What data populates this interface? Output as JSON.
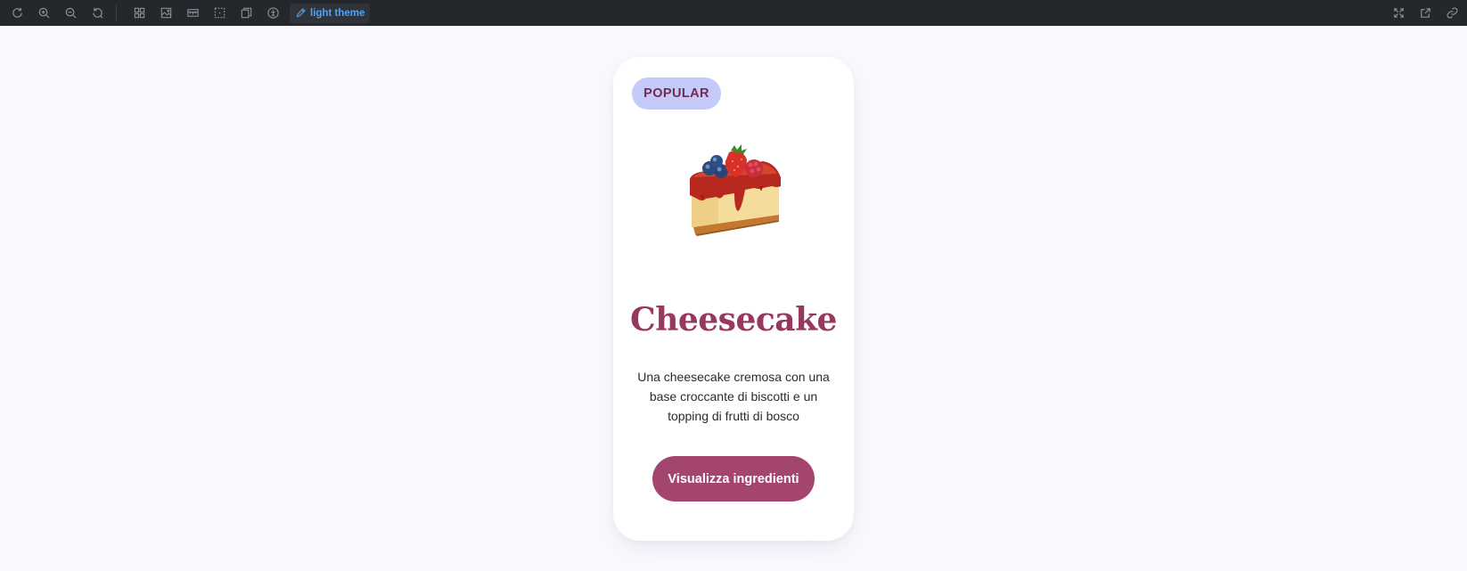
{
  "toolbar": {
    "left_icons": [
      "refresh-icon",
      "zoom-in-icon",
      "zoom-out-icon",
      "reset-zoom-icon"
    ],
    "view_icons": [
      "grid-icon",
      "image-icon",
      "ruler-icon",
      "selection-icon",
      "layers-icon",
      "accessibility-icon"
    ],
    "theme_label": "light theme",
    "right_icons": [
      "fullscreen-icon",
      "open-external-icon",
      "link-icon"
    ],
    "icon_color": "#8a8f96",
    "accent_color": "#4ea3f5"
  },
  "card": {
    "badge": "POPULAR",
    "image_icon": "cheesecake-slice",
    "title": "Cheesecake",
    "description": "Una cheesecake cremosa con una base croccante di biscotti e un topping di frutti di bosco",
    "button_label": "Visualizza ingredienti",
    "colors": {
      "badge_bg": "#c5cbf8",
      "badge_text": "#6f2c55",
      "title": "#98385f",
      "button_bg": "#a4456f"
    }
  }
}
